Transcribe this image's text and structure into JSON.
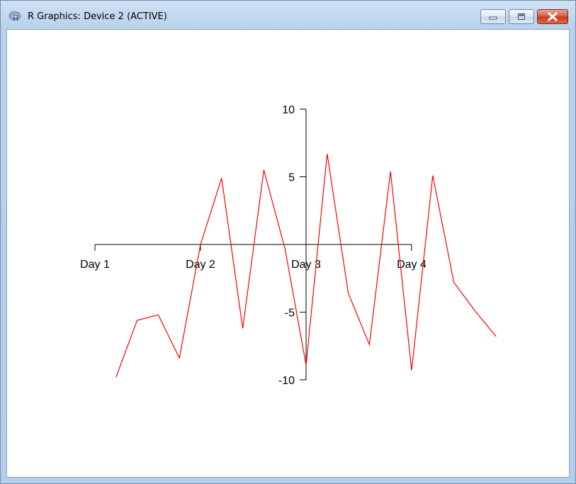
{
  "window": {
    "title": "R Graphics: Device 2 (ACTIVE)",
    "icon": "r-logo-icon",
    "controls": [
      "minimize-icon",
      "maximize-icon",
      "close-icon"
    ]
  },
  "chart_data": {
    "type": "line",
    "title": "",
    "xlabel": "",
    "ylabel": "",
    "x_ticks": [
      {
        "value": 1,
        "label": "Day 1"
      },
      {
        "value": 2,
        "label": "Day 2"
      },
      {
        "value": 3,
        "label": "Day 3"
      },
      {
        "value": 4,
        "label": "Day 4"
      }
    ],
    "y_ticks": [
      {
        "value": 10,
        "label": "10"
      },
      {
        "value": 5,
        "label": "5"
      },
      {
        "value": -5,
        "label": "-5"
      },
      {
        "value": -10,
        "label": "-10"
      }
    ],
    "xlim": [
      1,
      4
    ],
    "ylim": [
      -10,
      10
    ],
    "grid": false,
    "axes_cross_at_origin": true,
    "series": [
      {
        "color": "#ff0000",
        "x": [
          1.2,
          1.4,
          1.6,
          1.8,
          2.0,
          2.2,
          2.4,
          2.6,
          2.8,
          3.0,
          3.2,
          3.4,
          3.6,
          3.8,
          4.0,
          4.2,
          4.4,
          4.6,
          4.8
        ],
        "y": [
          -9.8,
          -5.6,
          -5.2,
          -8.4,
          0.0,
          4.9,
          -6.2,
          5.5,
          -0.3,
          -8.9,
          6.7,
          -3.6,
          -7.4,
          5.4,
          -9.3,
          5.1,
          -2.8,
          -4.9,
          -6.8
        ]
      }
    ]
  }
}
